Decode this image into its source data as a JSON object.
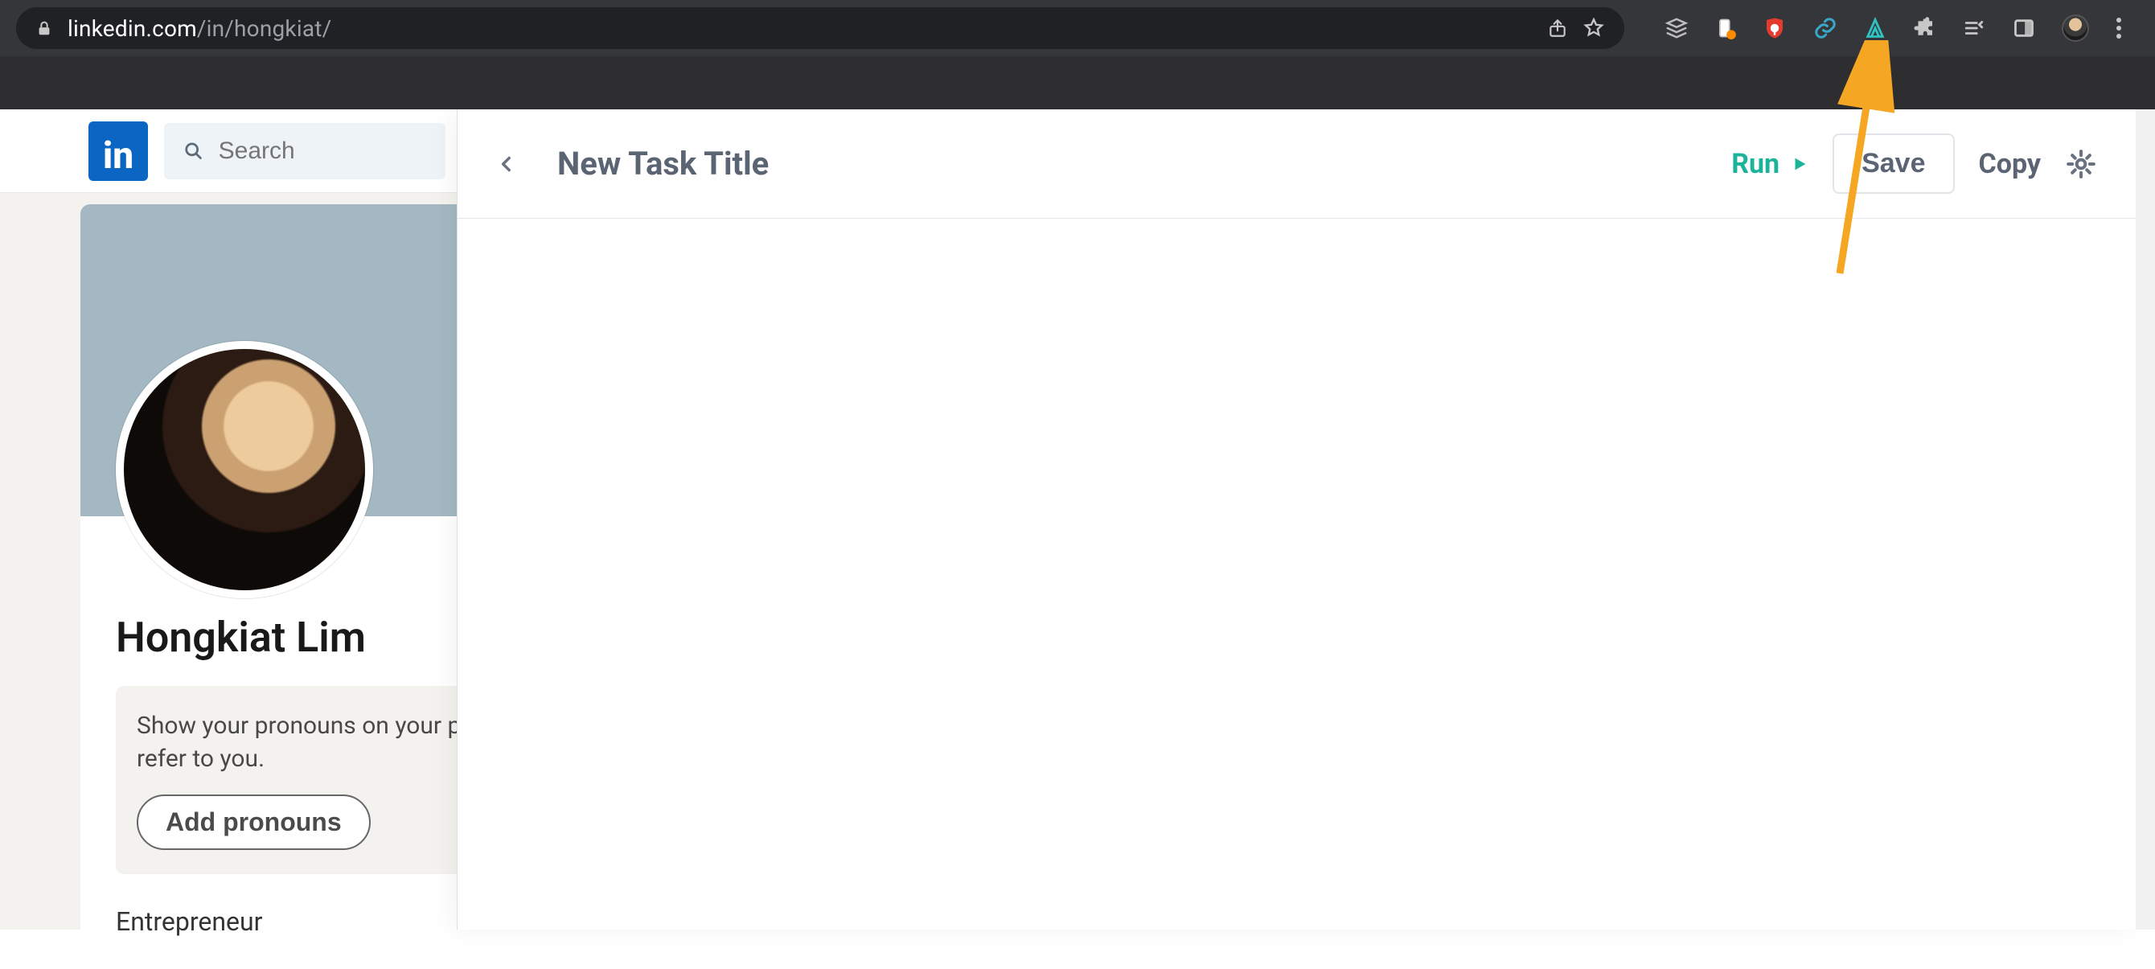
{
  "browser": {
    "url_host": "linkedin.com",
    "url_path": "/in/hongkiat/",
    "extensions": [
      "buffer-icon",
      "orange-badge-icon",
      "ublock-icon",
      "chainlink-icon",
      "axiom-icon",
      "puzzle-icon",
      "reading-list-icon",
      "sidepanel-icon"
    ]
  },
  "linkedin": {
    "logo_text": "in",
    "search_placeholder": "Search",
    "profile_name": "Hongkiat Lim",
    "pronoun_line1": "Show your pronouns on your p",
    "pronoun_line2": "refer to you.",
    "add_pronouns_label": "Add pronouns",
    "headline": "Entrepreneur"
  },
  "panel": {
    "title": "New Task Title",
    "run_label": "Run",
    "save_label": "Save",
    "copy_label": "Copy"
  }
}
